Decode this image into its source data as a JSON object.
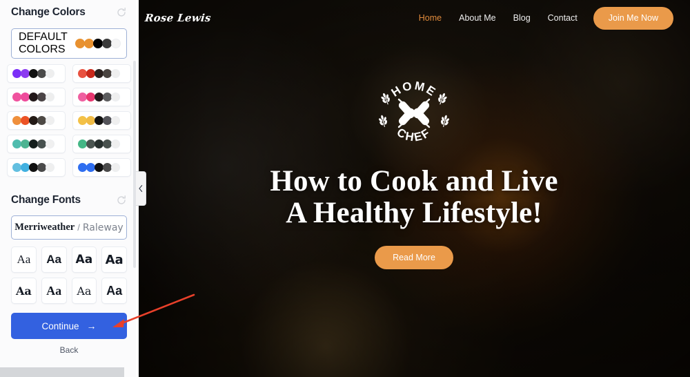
{
  "sidebar": {
    "colors_section": {
      "title": "Change Colors",
      "reset_icon": "reset-arrow-icon",
      "default_card": {
        "line1": "DEFAULT",
        "line2": "COLORS",
        "dots": [
          "#e8912f",
          "#e8912f",
          "#000000",
          "#3b3b3b",
          "#f4f4f4"
        ]
      },
      "palettes": [
        {
          "name": "purple",
          "dots": [
            "#7b2ff7",
            "#8b3bf0",
            "#111111",
            "#4a4a4a",
            "#eeeeee"
          ]
        },
        {
          "name": "red",
          "dots": [
            "#e8513f",
            "#c8281a",
            "#2a211e",
            "#4a4440",
            "#efefef"
          ]
        },
        {
          "name": "pink",
          "dots": [
            "#f0529e",
            "#ee4b9b",
            "#23191a",
            "#4b4446",
            "#eeeeee"
          ]
        },
        {
          "name": "rose",
          "dots": [
            "#ef5fa0",
            "#e8366f",
            "#231b1c",
            "#5c5c5e",
            "#efefef"
          ]
        },
        {
          "name": "orange",
          "dots": [
            "#ef8f3c",
            "#ec5326",
            "#231a16",
            "#4d4945",
            "#efefef"
          ]
        },
        {
          "name": "yellow",
          "dots": [
            "#f3c147",
            "#f0bb46",
            "#121212",
            "#54545a",
            "#efefef"
          ]
        },
        {
          "name": "teal",
          "dots": [
            "#4fbcae",
            "#4db492",
            "#151f1d",
            "#47504e",
            "#f0f0f0"
          ]
        },
        {
          "name": "green",
          "dots": [
            "#44b786",
            "#4a5450",
            "#27302e",
            "#48514e",
            "#efefef"
          ]
        },
        {
          "name": "sky",
          "dots": [
            "#63bfe0",
            "#41b0e0",
            "#111111",
            "#4a4a4a",
            "#efefef"
          ]
        },
        {
          "name": "blue",
          "dots": [
            "#2f6ef0",
            "#2f6ef0",
            "#111111",
            "#4a4a4a",
            "#efefef"
          ]
        }
      ]
    },
    "fonts_section": {
      "title": "Change Fonts",
      "reset_icon": "reset-arrow-icon",
      "selected_pair": {
        "primary": "Merriweather",
        "separator": "/",
        "secondary": "Raleway"
      },
      "tiles": [
        {
          "sample": "Aa"
        },
        {
          "sample": "Aa"
        },
        {
          "sample": "Aa"
        },
        {
          "sample": "Aa"
        },
        {
          "sample": "Aa"
        },
        {
          "sample": "Aa"
        },
        {
          "sample": "Aa"
        },
        {
          "sample": "Aa"
        }
      ]
    },
    "continue_label": "Continue",
    "continue_arrow": "→",
    "back_label": "Back",
    "collapse_handle_icon": "chevron-left-icon",
    "accent_color": "#3361e0"
  },
  "preview": {
    "nav": {
      "logo": "Rose Lewis",
      "links": [
        {
          "label": "Home",
          "active": true
        },
        {
          "label": "About Me",
          "active": false
        },
        {
          "label": "Blog",
          "active": false
        },
        {
          "label": "Contact",
          "active": false
        }
      ],
      "cta_label": "Join Me Now",
      "cta_color": "#ea9a4a"
    },
    "hero": {
      "badge": {
        "top_text": "HOME",
        "bottom_text": "CHEF",
        "emblem": "crossed-rolling-pins-icon"
      },
      "headline_line1": "How to Cook and Live",
      "headline_line2": "A Healthy Lifestyle!",
      "cta_label": "Read More",
      "cta_color": "#ea9a4a"
    }
  },
  "annotation": {
    "arrow_color": "#e8402a"
  }
}
